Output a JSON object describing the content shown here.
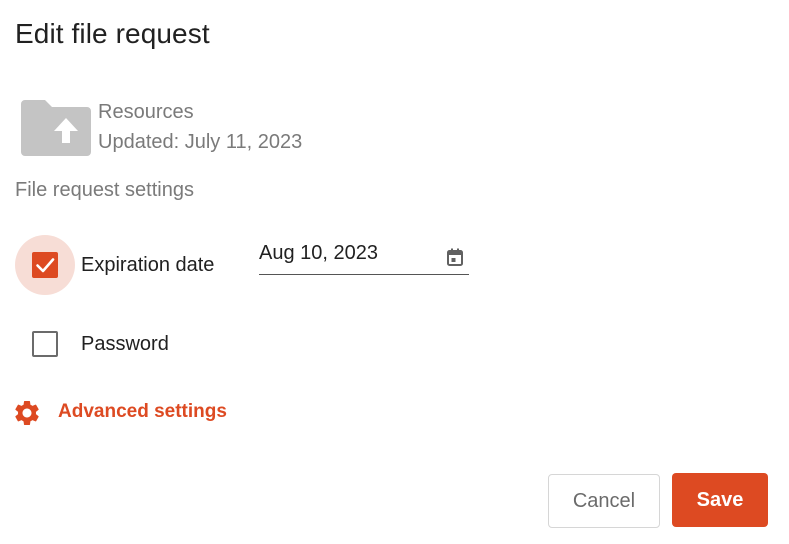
{
  "dialog": {
    "title": "Edit file request"
  },
  "folder": {
    "icon": "folder-upload-icon",
    "name": "Resources",
    "updated": "Updated: July 11, 2023"
  },
  "settings": {
    "section_label": "File request settings",
    "expiration": {
      "label": "Expiration date",
      "checked": true,
      "date_value": "Aug 10, 2023"
    },
    "password": {
      "label": "Password",
      "checked": false
    },
    "advanced_label": "Advanced settings"
  },
  "actions": {
    "cancel_label": "Cancel",
    "save_label": "Save"
  },
  "colors": {
    "accent": "#dd4a22",
    "halo": "#f7ddd6",
    "folder": "#c4c4c4"
  }
}
